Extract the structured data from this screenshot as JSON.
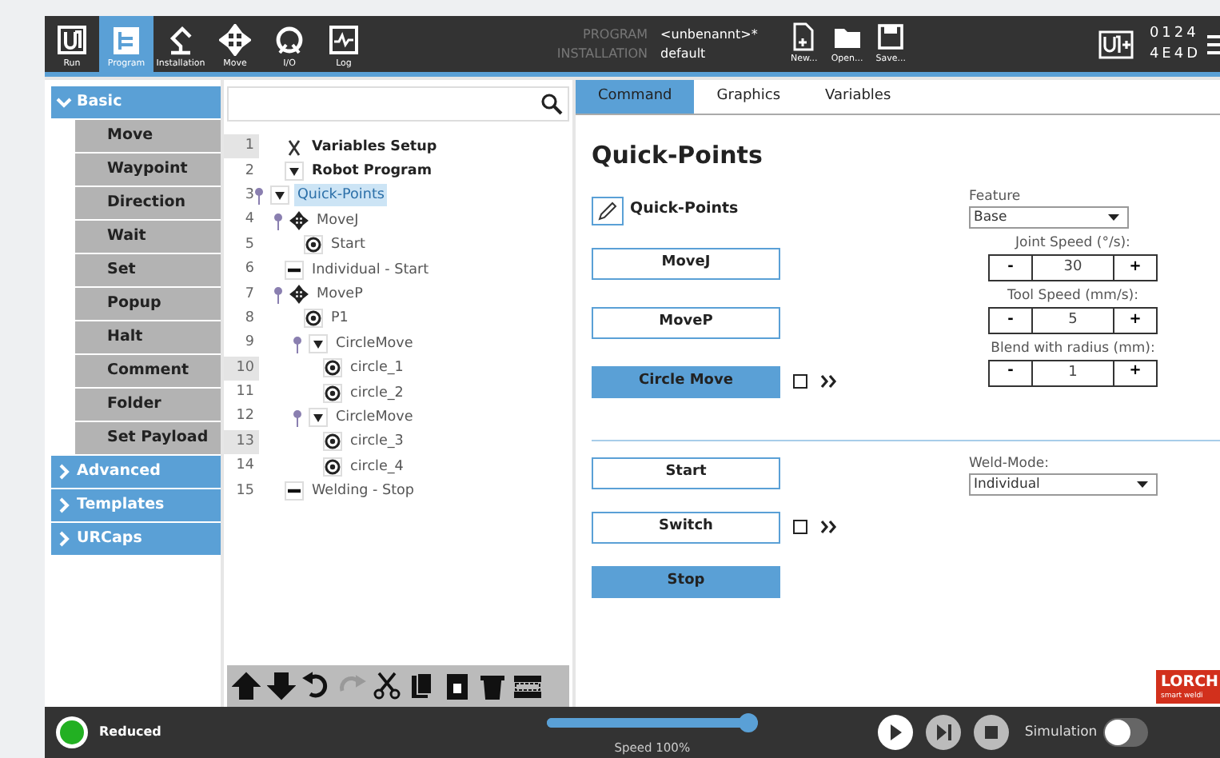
{
  "header": {
    "nav": [
      {
        "label": "Run",
        "kind": "run",
        "selected": false
      },
      {
        "label": "Program",
        "kind": "program",
        "selected": true
      },
      {
        "label": "Installation",
        "kind": "installation",
        "selected": false
      },
      {
        "label": "Move",
        "kind": "move",
        "selected": false
      },
      {
        "label": "I/O",
        "kind": "io",
        "selected": false
      },
      {
        "label": "Log",
        "kind": "log",
        "selected": false
      }
    ],
    "program_label": "PROGRAM",
    "program_name": "<unbenannt>*",
    "installation_label": "INSTALLATION",
    "installation_name": "default",
    "file_buttons": [
      {
        "label": "New...",
        "kind": "new"
      },
      {
        "label": "Open...",
        "kind": "open"
      },
      {
        "label": "Save...",
        "kind": "save"
      }
    ],
    "serial": [
      "0124",
      "4E4D"
    ]
  },
  "sidebar": {
    "categories": [
      {
        "label": "Basic",
        "expanded": true,
        "items": [
          "Move",
          "Waypoint",
          "Direction",
          "Wait",
          "Set",
          "Popup",
          "Halt",
          "Comment",
          "Folder",
          "Set Payload"
        ]
      },
      {
        "label": "Advanced",
        "expanded": false
      },
      {
        "label": "Templates",
        "expanded": false
      },
      {
        "label": "URCaps",
        "expanded": false
      }
    ]
  },
  "tree": {
    "rows": [
      {
        "number": "1",
        "text": "Variables Setup",
        "kind": "variables",
        "bold": true,
        "marked": true,
        "selected": false
      },
      {
        "number": "2",
        "text": "Robot Program",
        "kind": "folder",
        "bold": true,
        "marked": false,
        "selected": false,
        "children": [
          {
            "number": "3",
            "text": "Quick-Points",
            "kind": "folder",
            "bold": false,
            "marked": false,
            "selected": true,
            "expanded": true,
            "children": [
              {
                "number": "4",
                "text": "MoveJ",
                "kind": "move",
                "bold": false,
                "marked": false,
                "selected": false,
                "expanded": true,
                "children": [
                  {
                    "number": "5",
                    "text": "Start",
                    "kind": "waypoint",
                    "bold": false,
                    "marked": false,
                    "selected": false
                  }
                ]
              },
              {
                "number": "6",
                "text": "Individual - Start",
                "kind": "set",
                "bold": false,
                "marked": false,
                "selected": false
              },
              {
                "number": "7",
                "text": "MoveP",
                "kind": "move",
                "bold": false,
                "marked": false,
                "selected": false,
                "expanded": true,
                "children": [
                  {
                    "number": "8",
                    "text": "P1",
                    "kind": "waypoint",
                    "bold": false,
                    "marked": false,
                    "selected": false
                  },
                  {
                    "number": "9",
                    "text": "CircleMove",
                    "kind": "folder",
                    "bold": false,
                    "marked": false,
                    "selected": false,
                    "expanded": true,
                    "children": [
                      {
                        "number": "10",
                        "text": "circle_1",
                        "kind": "waypoint",
                        "bold": false,
                        "marked": true,
                        "selected": false
                      },
                      {
                        "number": "11",
                        "text": "circle_2",
                        "kind": "waypoint",
                        "bold": false,
                        "marked": false,
                        "selected": false
                      }
                    ]
                  },
                  {
                    "number": "12",
                    "text": "CircleMove",
                    "kind": "folder",
                    "bold": false,
                    "marked": false,
                    "selected": false,
                    "expanded": true,
                    "children": [
                      {
                        "number": "13",
                        "text": "circle_3",
                        "kind": "waypoint",
                        "bold": false,
                        "marked": true,
                        "selected": false
                      },
                      {
                        "number": "14",
                        "text": "circle_4",
                        "kind": "waypoint",
                        "bold": false,
                        "marked": false,
                        "selected": false
                      }
                    ]
                  }
                ]
              },
              {
                "number": "15",
                "text": "Welding - Stop",
                "kind": "set",
                "bold": false,
                "marked": false,
                "selected": false
              }
            ]
          }
        ]
      }
    ],
    "toolbar": [
      {
        "kind": "up",
        "disabled": false
      },
      {
        "kind": "down",
        "disabled": false
      },
      {
        "kind": "undo",
        "disabled": false
      },
      {
        "kind": "redo",
        "disabled": true
      },
      {
        "kind": "cut",
        "disabled": false
      },
      {
        "kind": "copy",
        "disabled": false
      },
      {
        "kind": "paste",
        "disabled": false
      },
      {
        "kind": "delete",
        "disabled": false
      },
      {
        "kind": "suppress",
        "disabled": false
      }
    ]
  },
  "panel": {
    "tabs": [
      {
        "label": "Command",
        "selected": true
      },
      {
        "label": "Graphics",
        "selected": false
      },
      {
        "label": "Variables",
        "selected": false
      }
    ],
    "title": "Quick-Points",
    "name_field": {
      "value": "Quick-Points"
    },
    "upper_buttons": [
      {
        "label": "MoveJ",
        "selected": false
      },
      {
        "label": "MoveP",
        "selected": false
      },
      {
        "label": "Circle Move",
        "selected": true,
        "checkbox": {
          "checked": false
        }
      }
    ],
    "feature": {
      "label": "Feature",
      "value": "Base"
    },
    "spinners": [
      {
        "label": "Joint Speed (°/s):",
        "value": "30",
        "minus": "-",
        "plus": "+"
      },
      {
        "label": "Tool Speed (mm/s):",
        "value": "5",
        "minus": "-",
        "plus": "+"
      },
      {
        "label": "Blend with radius (mm):",
        "value": "1",
        "minus": "-",
        "plus": "+"
      }
    ],
    "lower_buttons": [
      {
        "label": "Start",
        "selected": false
      },
      {
        "label": "Switch",
        "selected": false,
        "checkbox": {
          "checked": false
        }
      },
      {
        "label": "Stop",
        "selected": true
      }
    ],
    "weld_mode": {
      "label": "Weld-Mode:",
      "value": "Individual"
    },
    "logo": {
      "name": "LORCH",
      "tagline": "smart weldi"
    }
  },
  "footer": {
    "status": "Reduced",
    "speed": {
      "level": 1,
      "reading": "Speed 100%"
    },
    "simulation": {
      "label": "Simulation",
      "on": false
    }
  }
}
